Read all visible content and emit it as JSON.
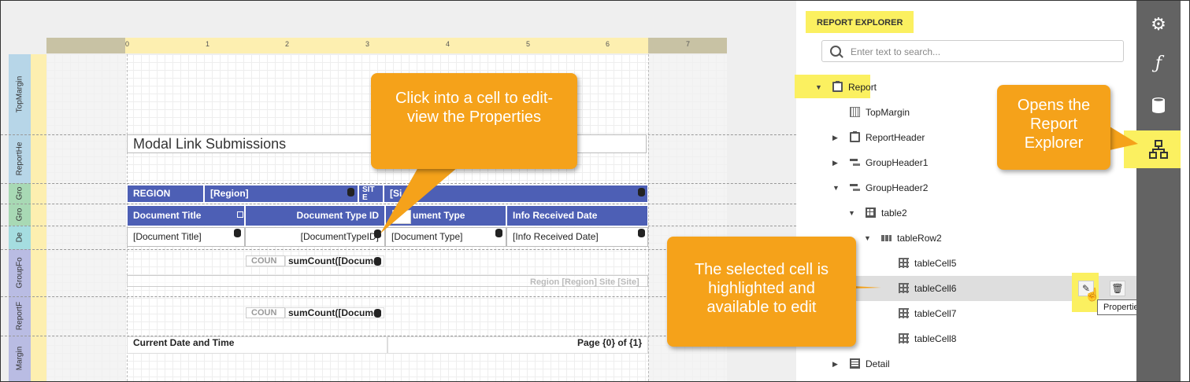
{
  "designer": {
    "ruler_numbers": [
      "0",
      "1",
      "2",
      "3",
      "4",
      "5",
      "6",
      "7"
    ],
    "bands": [
      "TopMargin",
      "ReportHe",
      "Gro",
      "Gro",
      "De",
      "GroupFo",
      "ReportF",
      "Margin"
    ],
    "report_title": "Modal Link Submissions",
    "group_header1": {
      "region_label": "REGION",
      "region_value": "[Region]",
      "site_label": "SIT E",
      "site_value": "[Si"
    },
    "table_headers": [
      "Document Title",
      "Document Type ID",
      "ument Type",
      "Info Received Date"
    ],
    "table_values": [
      "[Document Title]",
      "[DocumentTypeID]",
      "[Document Type]",
      "[Info Received Date]"
    ],
    "group_footer": {
      "count_label": "COUN",
      "sum_value": "sumCount([Docume",
      "summary_text": "Region [Region] Site [Site]"
    },
    "report_footer": {
      "count_label": "COUN",
      "sum_value": "sumCount([Docume"
    },
    "page_footer": {
      "left": "Current Date and Time",
      "right": "Page {0} of {1}"
    }
  },
  "callouts": {
    "click_cell": "Click into a cell to edit-view the Properties",
    "selected_cell": "The selected cell is highlighted and available to edit",
    "opens_explorer": "Opens the Report Explorer"
  },
  "explorer": {
    "title": "REPORT EXPLORER",
    "search_placeholder": "Enter text to search...",
    "tree": [
      {
        "label": "Report",
        "icon": "report-icon",
        "expanded": true
      },
      {
        "label": "TopMargin",
        "icon": "margin-icon"
      },
      {
        "label": "ReportHeader",
        "icon": "report-header-icon",
        "expanded": false
      },
      {
        "label": "GroupHeader1",
        "icon": "group-header-icon",
        "expanded": false
      },
      {
        "label": "GroupHeader2",
        "icon": "group-header-icon",
        "expanded": true
      },
      {
        "label": "table2",
        "icon": "table-icon",
        "expanded": true
      },
      {
        "label": "tableRow2",
        "icon": "table-row-icon",
        "expanded": true
      },
      {
        "label": "tableCell5",
        "icon": "table-cell-icon"
      },
      {
        "label": "tableCell6",
        "icon": "table-cell-icon",
        "selected": true
      },
      {
        "label": "tableCell7",
        "icon": "table-cell-icon"
      },
      {
        "label": "tableCell8",
        "icon": "table-cell-icon"
      },
      {
        "label": "Detail",
        "icon": "detail-icon",
        "expanded": false
      }
    ],
    "tooltip": "Properties"
  },
  "toolbar": {
    "items": [
      "gear-icon",
      "function-icon",
      "database-icon",
      "report-explorer-icon"
    ],
    "function_glyph": "ƒ"
  },
  "colors": {
    "highlight": "#fbf060",
    "callout": "#f5a21a",
    "table_header": "#4d5fb5",
    "toolbar": "#636363"
  }
}
